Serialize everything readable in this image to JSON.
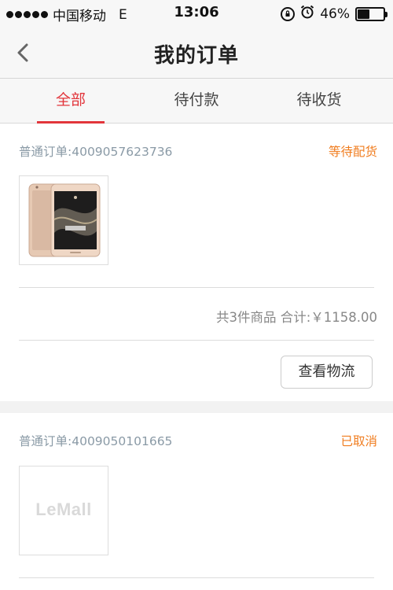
{
  "status_bar": {
    "carrier": "中国移动",
    "network": "E",
    "time": "13:06",
    "battery_percent": "46%",
    "battery_level": 0.46,
    "icons": [
      "signal-dots-icon",
      "rotation-lock-icon",
      "alarm-icon",
      "battery-icon"
    ]
  },
  "nav": {
    "title": "我的订单",
    "back_icon": "chevron-left-icon"
  },
  "tabs": [
    {
      "label": "全部",
      "active": true
    },
    {
      "label": "待付款",
      "active": false
    },
    {
      "label": "待收货",
      "active": false
    }
  ],
  "orders": [
    {
      "order_label": "普通订单:4009057623736",
      "status": "等待配货",
      "summary": "共3件商品  合计:￥1158.00",
      "button": "查看物流",
      "thumbnail": "phone-product-image"
    },
    {
      "order_label": "普通订单:4009050101665",
      "status": "已取消",
      "thumbnail_text": "LeMall"
    }
  ],
  "colors": {
    "accent": "#e2353b",
    "status_orange": "#f07c1e",
    "muted_blue_gray": "#8a9aa6"
  }
}
